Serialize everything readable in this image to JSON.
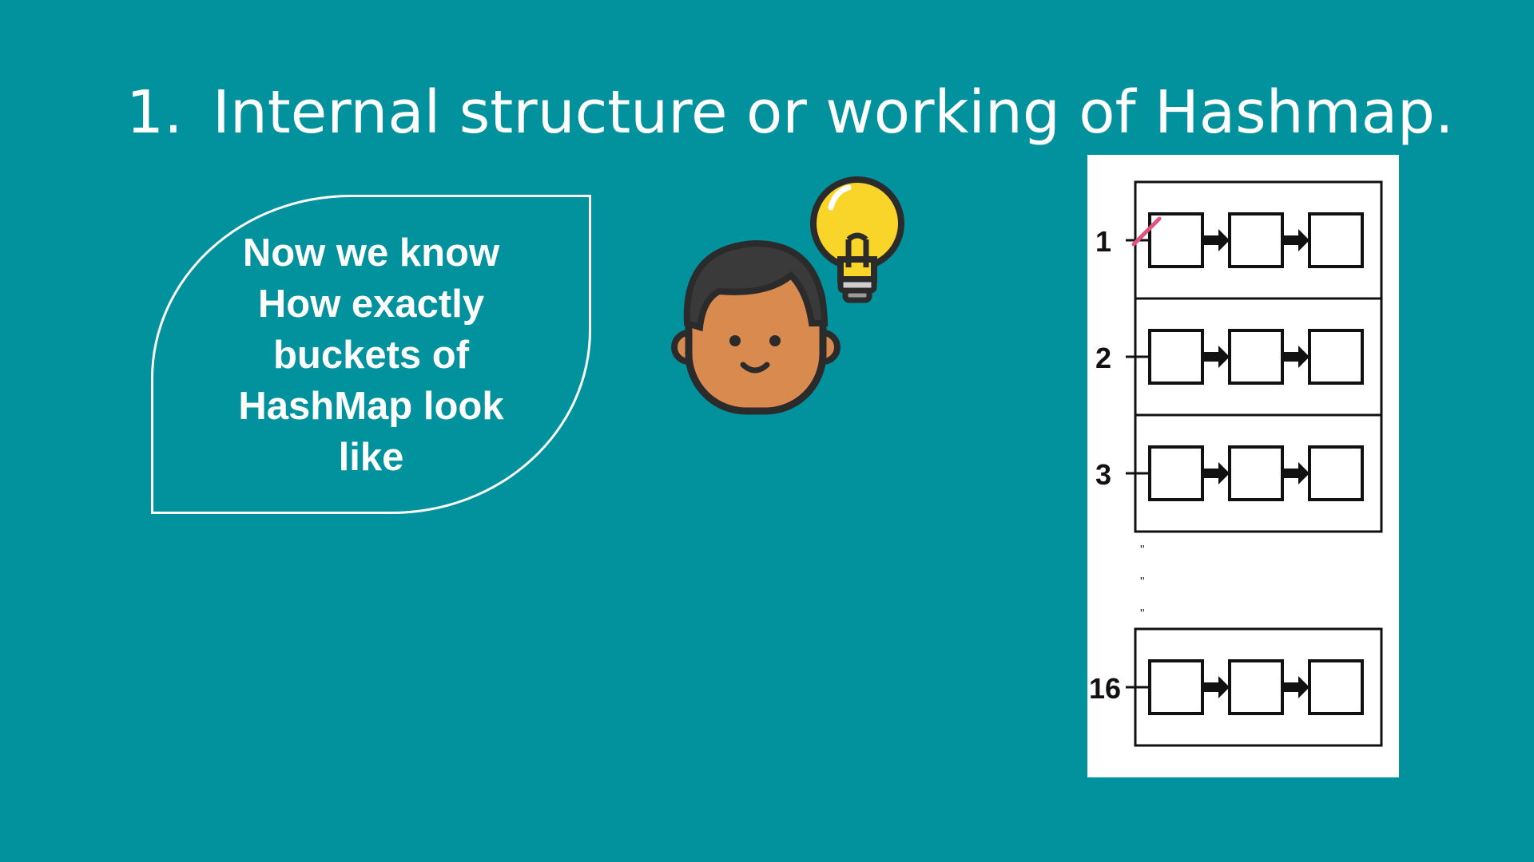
{
  "slide": {
    "title_number": "1.",
    "title_text": "Internal structure or working of Hashmap.",
    "bubble_lines": [
      "Now we know",
      "How exactly",
      "buckets of",
      "HashMap look",
      "like"
    ]
  },
  "illustration": {
    "person_icon": "person-with-lightbulb-icon",
    "lightbulb_color": "#F9D52A",
    "skin_color": "#D98A4E",
    "hair_color": "#3A3A3A"
  },
  "diagram": {
    "buckets": [
      {
        "label": "1",
        "nodes": 3
      },
      {
        "label": "2",
        "nodes": 3
      },
      {
        "label": "3",
        "nodes": 3
      },
      {
        "label": "16",
        "nodes": 3
      }
    ],
    "ellipsis_marks": [
      "\"",
      "\"",
      "\""
    ],
    "marker_color": "#E0537A"
  },
  "colors": {
    "background": "#02929E",
    "text": "#FFFFFF",
    "panel": "#FFFFFF"
  }
}
